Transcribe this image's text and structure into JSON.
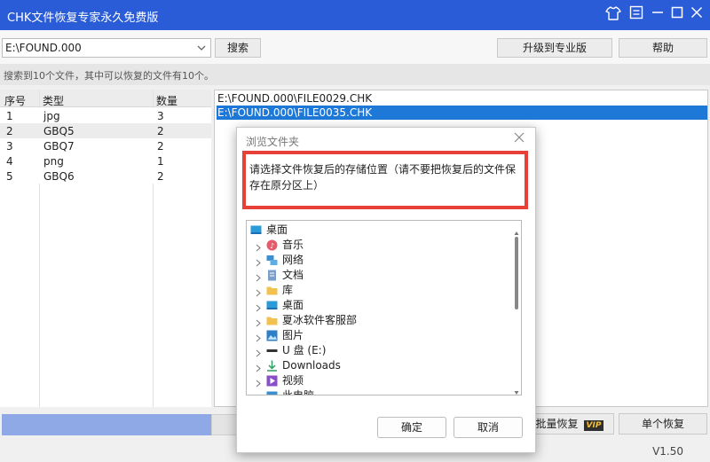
{
  "app": {
    "title": "CHK文件恢复专家永久免费版"
  },
  "toolbar": {
    "path_value": "E:\\FOUND.000",
    "search_label": "搜索",
    "upgrade_label": "升级到专业版",
    "help_label": "帮助"
  },
  "status": {
    "text": "搜索到10个文件，其中可以恢复的文件有10个。"
  },
  "file_types": {
    "headers": [
      "序号",
      "类型",
      "数量"
    ],
    "rows": [
      {
        "index": "1",
        "type": "jpg",
        "count": "3"
      },
      {
        "index": "2",
        "type": "GBQ5",
        "count": "2"
      },
      {
        "index": "3",
        "type": "GBQ7",
        "count": "2"
      },
      {
        "index": "4",
        "type": "png",
        "count": "1"
      },
      {
        "index": "5",
        "type": "GBQ6",
        "count": "2"
      }
    ]
  },
  "files": [
    "E:\\FOUND.000\\FILE0029.CHK",
    "E:\\FOUND.000\\FILE0035.CHK"
  ],
  "bottom": {
    "batch_label": "批量恢复",
    "vip_label": "VIP",
    "single_label": "单个恢复",
    "version": "V1.50"
  },
  "dialog": {
    "title": "浏览文件夹",
    "message": "请选择文件恢复后的存储位置（请不要把恢复后的文件保存在原分区上）",
    "tree": [
      {
        "label": "桌面",
        "icon": "desktop-icon",
        "expandable": false
      },
      {
        "label": "音乐",
        "icon": "music-icon",
        "expandable": true
      },
      {
        "label": "网络",
        "icon": "network-icon",
        "expandable": true
      },
      {
        "label": "文档",
        "icon": "document-icon",
        "expandable": true
      },
      {
        "label": "库",
        "icon": "folder-icon",
        "expandable": true
      },
      {
        "label": "桌面",
        "icon": "desktop-icon",
        "expandable": true
      },
      {
        "label": "夏冰软件客服部",
        "icon": "folder-icon",
        "expandable": true
      },
      {
        "label": "图片",
        "icon": "pictures-icon",
        "expandable": true
      },
      {
        "label": "U 盘 (E:)",
        "icon": "usb-drive-icon",
        "expandable": true
      },
      {
        "label": "Downloads",
        "icon": "download-icon",
        "expandable": true
      },
      {
        "label": "视频",
        "icon": "video-icon",
        "expandable": true
      },
      {
        "label": "此电脑",
        "icon": "computer-icon",
        "expandable": true
      }
    ],
    "ok_label": "确定",
    "cancel_label": "取消"
  }
}
